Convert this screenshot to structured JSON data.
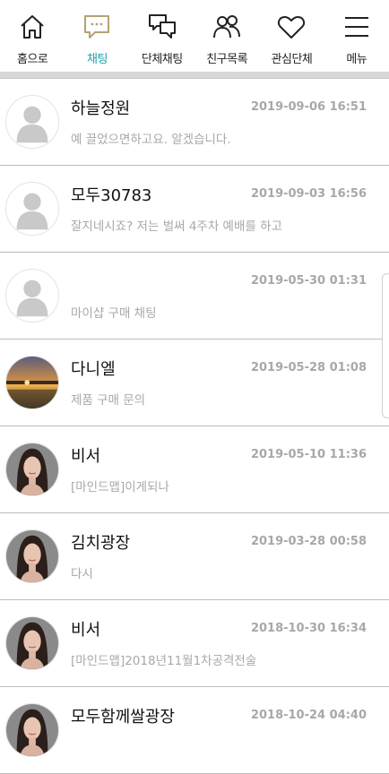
{
  "nav": [
    {
      "label": "홈으로",
      "icon": "home-icon"
    },
    {
      "label": "채팅",
      "icon": "chat-bubble-icon",
      "active": true
    },
    {
      "label": "단체채팅",
      "icon": "group-chat-icon"
    },
    {
      "label": "친구목록",
      "icon": "friends-icon"
    },
    {
      "label": "관심단체",
      "icon": "heart-icon"
    },
    {
      "label": "메뉴",
      "icon": "hamburger-menu-icon"
    }
  ],
  "accent_color": "#1aa3a8",
  "chats": [
    {
      "name": "하늘정원",
      "time": "2019-09-06 16:51",
      "preview": "예 끌었으면하고요. 알겠습니다.",
      "avatar": "default-avatar"
    },
    {
      "name": "모두30783",
      "time": "2019-09-03 16:56",
      "preview": "잘지네시죠? 저는 벌써 4주차 예배를 하고",
      "avatar": "default-avatar"
    },
    {
      "name": "",
      "time": "2019-05-30 01:31",
      "preview": "마이샵 구매 채팅",
      "avatar": "default-avatar"
    },
    {
      "name": "다니엘",
      "time": "2019-05-28 01:08",
      "preview": "제품 구매 문의",
      "avatar": "sunset-avatar"
    },
    {
      "name": "비서",
      "time": "2019-05-10 11:36",
      "preview": "[마인드맵]이게되나",
      "avatar": "woman-avatar"
    },
    {
      "name": "김치광장",
      "time": "2019-03-28 00:58",
      "preview": "다시",
      "avatar": "woman-avatar"
    },
    {
      "name": "비서",
      "time": "2018-10-30 16:34",
      "preview": "[마인드맵]2018년11월1차공격전술",
      "avatar": "woman-avatar"
    },
    {
      "name": "모두함께쌀광장",
      "time": "2018-10-24 04:40",
      "preview": "",
      "avatar": "woman-avatar"
    }
  ]
}
